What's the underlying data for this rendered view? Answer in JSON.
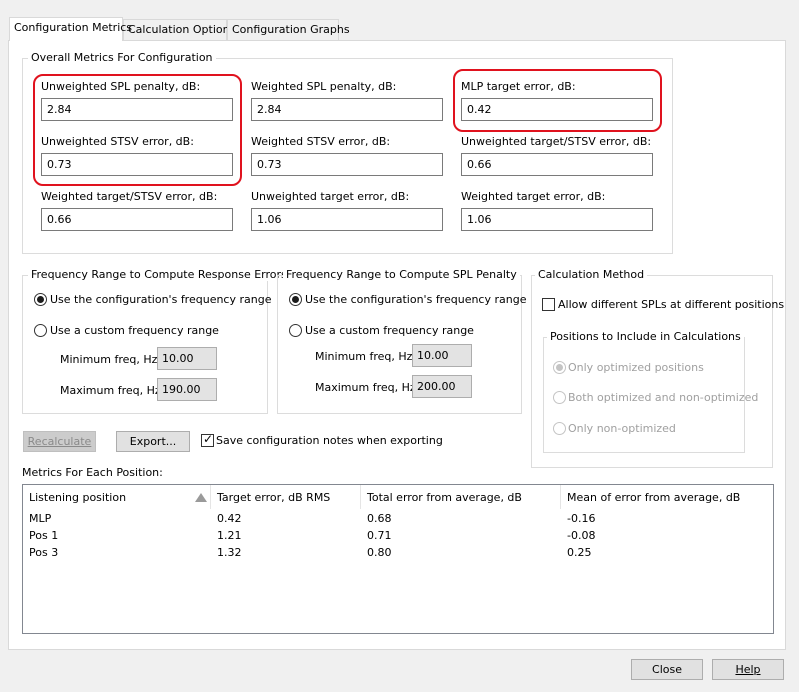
{
  "tabs": [
    {
      "label": "Configuration Metrics",
      "active": true
    },
    {
      "label": "Calculation Options",
      "active": false
    },
    {
      "label": "Configuration Graphs",
      "active": false
    }
  ],
  "overall": {
    "title": "Overall Metrics For Configuration",
    "fields": [
      {
        "label": "Unweighted SPL penalty, dB:",
        "value": "2.84"
      },
      {
        "label": "Weighted SPL penalty, dB:",
        "value": "2.84"
      },
      {
        "label": "MLP target error, dB:",
        "value": "0.42"
      },
      {
        "label": "Unweighted STSV error, dB:",
        "value": "0.73"
      },
      {
        "label": "Weighted STSV error, dB:",
        "value": "0.73"
      },
      {
        "label": "Unweighted target/STSV error, dB:",
        "value": "0.66"
      },
      {
        "label": "Weighted target/STSV error, dB:",
        "value": "0.66"
      },
      {
        "label": "Unweighted target error, dB:",
        "value": "1.06"
      },
      {
        "label": "Weighted target error, dB:",
        "value": "1.06"
      }
    ]
  },
  "freq_response": {
    "title": "Frequency Range to Compute Response Errors",
    "opt_config": "Use the configuration's frequency range",
    "opt_custom": "Use a custom frequency range",
    "min_label": "Minimum freq, Hz:",
    "min_value": "10.00",
    "max_label": "Maximum freq, Hz:",
    "max_value": "190.00"
  },
  "freq_spl": {
    "title": "Frequency Range to Compute SPL Penalty",
    "opt_config": "Use the configuration's frequency range",
    "opt_custom": "Use a custom frequency range",
    "min_label": "Minimum freq, Hz:",
    "min_value": "10.00",
    "max_label": "Maximum freq, Hz:",
    "max_value": "200.00"
  },
  "calc_method": {
    "title": "Calculation Method",
    "allow_label": "Allow different SPLs at different positions",
    "positions_title": "Positions to Include in Calculations",
    "opt_optimized": "Only optimized positions",
    "opt_both": "Both optimized and non-optimized",
    "opt_nonopt": "Only non-optimized"
  },
  "actions": {
    "recalculate": "Recalculate",
    "export": "Export...",
    "save_notes": "Save configuration notes when exporting"
  },
  "metrics_table": {
    "title": "Metrics For Each Position:",
    "columns": [
      "Listening position",
      "Target error, dB RMS",
      "Total error from average, dB",
      "Mean of error from average, dB"
    ],
    "rows": [
      [
        "MLP",
        "0.42",
        "0.68",
        "-0.16"
      ],
      [
        "Pos 1",
        "1.21",
        "0.71",
        "-0.08"
      ],
      [
        "Pos 3",
        "1.32",
        "0.80",
        "0.25"
      ]
    ]
  },
  "footer": {
    "close": "Close",
    "help": "Help"
  },
  "colors": {
    "highlight": "#e0121e"
  }
}
